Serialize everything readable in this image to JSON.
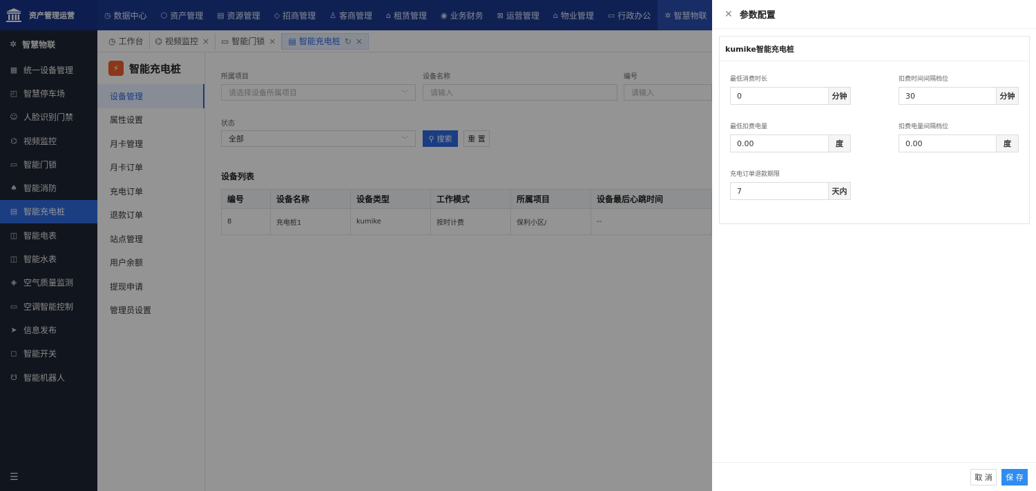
{
  "brand": {
    "name": "资产管理运营",
    "icon": "bank-icon"
  },
  "topnav": [
    {
      "icon": "◷",
      "label": "数据中心"
    },
    {
      "icon": "⬡",
      "label": "资产管理"
    },
    {
      "icon": "▤",
      "label": "资源管理"
    },
    {
      "icon": "◇",
      "label": "招商管理"
    },
    {
      "icon": "♙",
      "label": "客商管理"
    },
    {
      "icon": "⌂",
      "label": "租赁管理"
    },
    {
      "icon": "◉",
      "label": "业务财务"
    },
    {
      "icon": "⊠",
      "label": "运营管理"
    },
    {
      "icon": "⌂",
      "label": "物业管理"
    },
    {
      "icon": "▭",
      "label": "行政办公"
    },
    {
      "icon": "✲",
      "label": "智慧物联"
    }
  ],
  "sidebar": {
    "header": {
      "icon": "✲",
      "label": "智慧物联"
    },
    "items": [
      {
        "icon": "▦",
        "label": "统一设备管理"
      },
      {
        "icon": "◰",
        "label": "智慧停车场"
      },
      {
        "icon": "☺",
        "label": "人脸识别门禁"
      },
      {
        "icon": "⌬",
        "label": "视频监控"
      },
      {
        "icon": "▭",
        "label": "智能门锁"
      },
      {
        "icon": "♠",
        "label": "智能消防"
      },
      {
        "icon": "▤",
        "label": "智能充电桩"
      },
      {
        "icon": "◫",
        "label": "智能电表"
      },
      {
        "icon": "◫",
        "label": "智能水表"
      },
      {
        "icon": "◈",
        "label": "空气质量监测"
      },
      {
        "icon": "▭",
        "label": "空调智能控制"
      },
      {
        "icon": "➤",
        "label": "信息发布"
      },
      {
        "icon": "◻",
        "label": "智能开关"
      },
      {
        "icon": "☋",
        "label": "智能机器人"
      }
    ],
    "footer_icon": "☰"
  },
  "tabs": [
    {
      "icon": "◷",
      "label": "工作台",
      "closable": false
    },
    {
      "icon": "⌬",
      "label": "视频监控",
      "closable": true
    },
    {
      "icon": "▭",
      "label": "智能门锁",
      "closable": true
    },
    {
      "icon": "▤",
      "label": "智能充电桩",
      "closable": true,
      "refresh": "↻"
    }
  ],
  "module": {
    "title": "智能充电桩",
    "items": [
      "设备管理",
      "属性设置",
      "月卡管理",
      "月卡订单",
      "充电订单",
      "退款订单",
      "站点管理",
      "用户余额",
      "提现申请",
      "管理员设置"
    ]
  },
  "filters": {
    "project_label": "所属项目",
    "project_placeholder": "请选择设备所属项目",
    "name_label": "设备名称",
    "name_placeholder": "请输入",
    "code_label": "编号",
    "code_placeholder": "请输入",
    "status_label": "状态",
    "status_value": "全部",
    "search_label": "搜索",
    "reset_label": "重 置"
  },
  "device_list": {
    "title": "设备列表",
    "columns": [
      "编号",
      "设备名称",
      "设备类型",
      "工作模式",
      "所属项目",
      "设备最后心跳时间"
    ],
    "rows": [
      [
        "8",
        "充电桩1",
        "kumike",
        "按时计费",
        "保利小区/",
        "--"
      ]
    ]
  },
  "drawer": {
    "title": "参数配置",
    "card_title": "kumike智能充电桩",
    "fields": [
      {
        "label": "最低消费时长",
        "value": "0",
        "unit": "分钟"
      },
      {
        "label": "扣费时间间隔档位",
        "value": "30",
        "unit": "分钟"
      },
      {
        "label": "最低扣费电量",
        "value": "0.00",
        "unit": "度"
      },
      {
        "label": "扣费电量间隔档位",
        "value": "0.00",
        "unit": "度"
      },
      {
        "label": "充电订单退款期限",
        "value": "7",
        "unit": "天内"
      }
    ],
    "cancel_label": "取 消",
    "save_label": "保 存"
  },
  "colors": {
    "topbar": "#1a3a8f",
    "sidebar": "#1e2532",
    "accent": "#2f6ae0",
    "save": "#2f8cf0"
  }
}
